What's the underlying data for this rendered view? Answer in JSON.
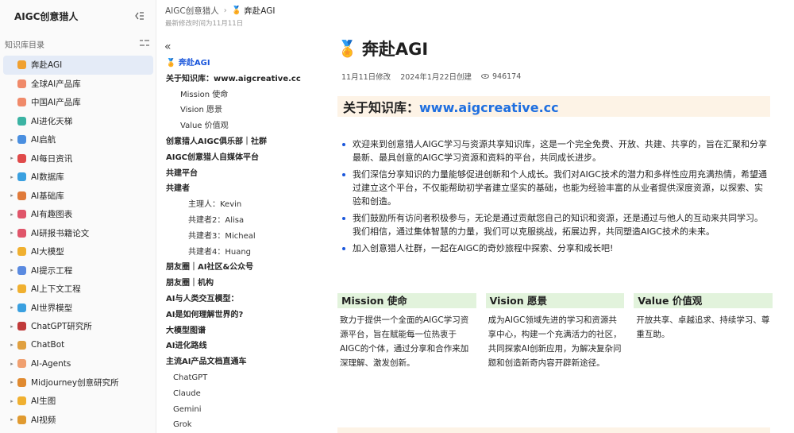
{
  "sidebar": {
    "title": "AIGC创意猎人",
    "section_label": "知识库目录",
    "items": [
      {
        "label": "奔赴AGI",
        "icon": "medal-icon",
        "caret": false,
        "active": true,
        "color": "#f0a030"
      },
      {
        "label": "全球AI产品库",
        "icon": "grid-icon",
        "caret": false,
        "active": false,
        "color": "#f08a6a"
      },
      {
        "label": "中国AI产品库",
        "icon": "grid-icon",
        "caret": false,
        "active": false,
        "color": "#f08a6a"
      },
      {
        "label": "AI进化天梯",
        "icon": "ladder-icon",
        "caret": false,
        "active": false,
        "color": "#3bb3a3"
      },
      {
        "label": "AI启航",
        "icon": "plane-icon",
        "caret": true,
        "active": false,
        "color": "#4a8fe0"
      },
      {
        "label": "AI每日资讯",
        "icon": "star-icon",
        "caret": true,
        "active": false,
        "color": "#e04a4a"
      },
      {
        "label": "AI数据库",
        "icon": "globe-icon",
        "caret": true,
        "active": false,
        "color": "#3aa0e0"
      },
      {
        "label": "AI基础库",
        "icon": "brush-icon",
        "caret": true,
        "active": false,
        "color": "#e07a3a"
      },
      {
        "label": "AI有趣图表",
        "icon": "mask-icon",
        "caret": true,
        "active": false,
        "color": "#e0556a"
      },
      {
        "label": "AI研报书籍论文",
        "icon": "mask-icon",
        "caret": true,
        "active": false,
        "color": "#e0556a"
      },
      {
        "label": "AI大模型",
        "icon": "emoji-icon",
        "caret": true,
        "active": false,
        "color": "#f0b030"
      },
      {
        "label": "AI提示工程",
        "icon": "hand-icon",
        "caret": true,
        "active": false,
        "color": "#5a8ae0"
      },
      {
        "label": "AI上下文工程",
        "icon": "emoji-icon",
        "caret": true,
        "active": false,
        "color": "#f0b030"
      },
      {
        "label": "AI世界模型",
        "icon": "globe-icon",
        "caret": true,
        "active": false,
        "color": "#3aa0e0"
      },
      {
        "label": "ChatGPT研究所",
        "icon": "shield-icon",
        "caret": true,
        "active": false,
        "color": "#c03a3a"
      },
      {
        "label": "ChatBot",
        "icon": "palette-icon",
        "caret": true,
        "active": false,
        "color": "#e0a040"
      },
      {
        "label": "AI-Agents",
        "icon": "baby-icon",
        "caret": true,
        "active": false,
        "color": "#f0a070"
      },
      {
        "label": "Midjourney创意研究所",
        "icon": "book-icon",
        "caret": true,
        "active": false,
        "color": "#e08a30"
      },
      {
        "label": "AI生图",
        "icon": "emoji-icon",
        "caret": true,
        "active": false,
        "color": "#f0b030"
      },
      {
        "label": "AI视频",
        "icon": "tiger-icon",
        "caret": true,
        "active": false,
        "color": "#e09a30"
      }
    ]
  },
  "topbar": {
    "crumb_root": "AIGC创意猎人",
    "crumb_current": "奔赴AGI",
    "modified": "最新修改时间为11月11日"
  },
  "toc": {
    "items": [
      {
        "label": "🏅 奔赴AGI",
        "level": "l1",
        "current": true
      },
      {
        "label": "关于知识库：www.aigcreative.cc",
        "level": "l1"
      },
      {
        "label": "Mission 使命",
        "level": "l2"
      },
      {
        "label": "Vision 愿景",
        "level": "l2"
      },
      {
        "label": "Value 价值观",
        "level": "l2"
      },
      {
        "label": "创意猎人AIGC俱乐部｜社群",
        "level": "l1"
      },
      {
        "label": "AIGC创意猎人自媒体平台",
        "level": "l1"
      },
      {
        "label": "共建平台",
        "level": "l1"
      },
      {
        "label": "共建者",
        "level": "l1"
      },
      {
        "label": "主理人：Kevin",
        "level": "l3"
      },
      {
        "label": "共建者2：Alisa",
        "level": "l3"
      },
      {
        "label": "共建者3：Micheal",
        "level": "l3"
      },
      {
        "label": "共建者4：Huang",
        "level": "l3"
      },
      {
        "label": "朋友圈｜AI社区&公众号",
        "level": "l1"
      },
      {
        "label": "朋友圈｜机构",
        "level": "l1"
      },
      {
        "label": "AI与人类交互模型：",
        "level": "l1"
      },
      {
        "label": "AI是如何理解世界的?",
        "level": "l1"
      },
      {
        "label": "大模型图谱",
        "level": "l1"
      },
      {
        "label": "AI进化路线",
        "level": "l1"
      },
      {
        "label": "主流AI产品文档直通车",
        "level": "l1"
      },
      {
        "label": "ChatGPT",
        "level": "l2b"
      },
      {
        "label": "Claude",
        "level": "l2b"
      },
      {
        "label": "Gemini",
        "level": "l2b"
      },
      {
        "label": "Grok",
        "level": "l2b"
      }
    ]
  },
  "doc": {
    "title": "奔赴AGI",
    "modified": "11月11日修改",
    "created": "2024年1月22日创建",
    "views": "946174",
    "h2_prefix": "关于知识库：",
    "h2_link": "www.aigcreative.cc",
    "bullets": [
      "欢迎来到创意猎人AIGC学习与资源共享知识库，这是一个完全免费、开放、共建、共享的，旨在汇聚和分享最新、最具创意的AIGC学习资源和资料的平台，共同成长进步。",
      "我们深信分享知识的力量能够促进创新和个人成长。我们对AIGC技术的潜力和多样性应用充满热情，希望通过建立这个平台，不仅能帮助初学者建立坚实的基础，也能为经验丰富的从业者提供深度资源，以探索、实验和创造。",
      "我们鼓励所有访问者积极参与，无论是通过贡献您自己的知识和资源，还是通过与他人的互动来共同学习。我们相信，通过集体智慧的力量，我们可以克服挑战，拓展边界，共同塑造AIGC技术的未来。",
      "加入创意猎人社群，一起在AIGC的奇妙旅程中探索、分享和成长吧!"
    ],
    "cards": [
      {
        "title": "Mission 使命",
        "body": "致力于提供一个全面的AIGC学习资源平台，旨在赋能每一位热衷于AIGC的个体，通过分享和合作来加深理解、激发创新。"
      },
      {
        "title": "Vision 愿景",
        "body": "成为AIGC领域先进的学习和资源共享中心，构建一个充满活力的社区，共同探索AI创新应用，为解决复杂问题和创造新奇内容开辟新途径。"
      },
      {
        "title": "Value 价值观",
        "body": "开放共享、卓越追求、持续学习、尊重互助。"
      }
    ]
  }
}
